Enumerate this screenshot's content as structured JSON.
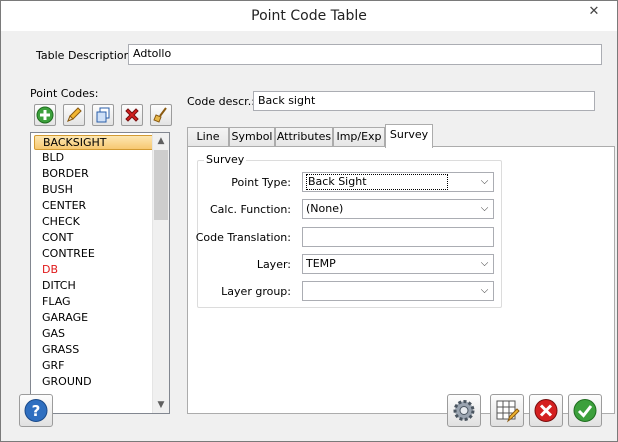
{
  "window": {
    "title": "Point Code Table",
    "close_glyph": "✕"
  },
  "table_description": {
    "label": "Table Description:",
    "value": "Adtollo"
  },
  "point_codes": {
    "label": "Point Codes:",
    "items": [
      {
        "label": "BACKSIGHT",
        "selected": true
      },
      {
        "label": "BLD"
      },
      {
        "label": "BORDER"
      },
      {
        "label": "BUSH"
      },
      {
        "label": "CENTER"
      },
      {
        "label": "CHECK"
      },
      {
        "label": "CONT"
      },
      {
        "label": "CONTREE"
      },
      {
        "label": "DB",
        "color": "#e0191a"
      },
      {
        "label": "DITCH"
      },
      {
        "label": "FLAG"
      },
      {
        "label": "GARAGE"
      },
      {
        "label": "GAS"
      },
      {
        "label": "GRASS"
      },
      {
        "label": "GRF"
      },
      {
        "label": "GROUND"
      }
    ]
  },
  "code_description": {
    "label": "Code descr.:",
    "value": "Back sight"
  },
  "tabs": [
    {
      "label": "Line"
    },
    {
      "label": "Symbol"
    },
    {
      "label": "Attributes"
    },
    {
      "label": "Imp/Exp"
    },
    {
      "label": "Survey",
      "active": true
    }
  ],
  "survey": {
    "group_title": "Survey",
    "point_type": {
      "label": "Point Type:",
      "value": "Back Sight"
    },
    "calc_function": {
      "label": "Calc. Function:",
      "value": "(None)"
    },
    "code_translation": {
      "label": "Code Translation:",
      "value": ""
    },
    "layer": {
      "label": "Layer:",
      "value": "TEMP"
    },
    "layer_group": {
      "label": "Layer group:",
      "value": ""
    }
  },
  "toolbar_icons": [
    "add-icon",
    "edit-pencil-icon",
    "copy-icon",
    "delete-icon",
    "broom-icon"
  ],
  "footer_icons": [
    "help-icon",
    "settings-gear-icon",
    "table-edit-icon",
    "cancel-icon",
    "ok-icon"
  ],
  "colors": {
    "selection_fill": "#f7c871",
    "selection_border": "#d39b33",
    "add_green": "#3ca03c",
    "delete_red": "#d42020",
    "help_blue": "#2f6fc0"
  }
}
